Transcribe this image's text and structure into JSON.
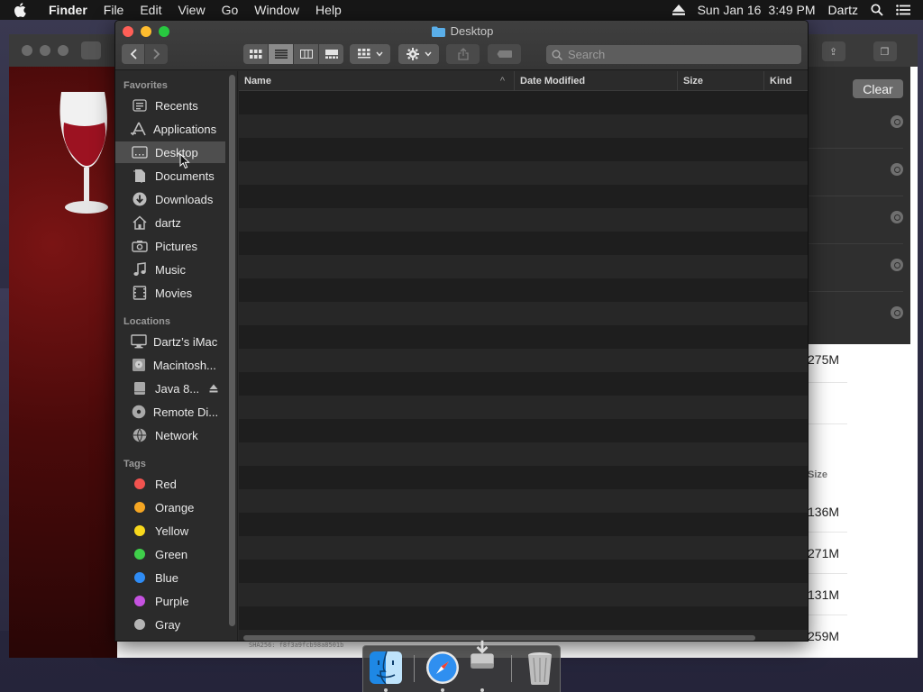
{
  "menubar": {
    "app_name": "Finder",
    "items": [
      "File",
      "Edit",
      "View",
      "Go",
      "Window",
      "Help"
    ],
    "date": "Sun Jan 16",
    "time": "3:49 PM",
    "user": "Dartz"
  },
  "finder": {
    "title": "Desktop",
    "search_placeholder": "Search",
    "columns": {
      "name": "Name",
      "date_modified": "Date Modified",
      "size": "Size",
      "kind": "Kind"
    },
    "rows": []
  },
  "sidebar": {
    "favorites_header": "Favorites",
    "favorites": [
      {
        "label": "Recents",
        "icon": "recents-icon"
      },
      {
        "label": "Applications",
        "icon": "applications-icon"
      },
      {
        "label": "Desktop",
        "icon": "desktop-icon",
        "selected": true
      },
      {
        "label": "Documents",
        "icon": "documents-icon"
      },
      {
        "label": "Downloads",
        "icon": "downloads-icon"
      },
      {
        "label": "dartz",
        "icon": "home-icon"
      },
      {
        "label": "Pictures",
        "icon": "pictures-icon"
      },
      {
        "label": "Music",
        "icon": "music-icon"
      },
      {
        "label": "Movies",
        "icon": "movies-icon"
      }
    ],
    "locations_header": "Locations",
    "locations": [
      {
        "label": "Dartz’s iMac",
        "icon": "computer-icon"
      },
      {
        "label": "Macintosh...",
        "icon": "hard-drive-icon"
      },
      {
        "label": "Java 8...",
        "icon": "disk-image-icon",
        "ejectable": true
      },
      {
        "label": "Remote Di...",
        "icon": "remote-disc-icon"
      },
      {
        "label": "Network",
        "icon": "network-icon"
      }
    ],
    "tags_header": "Tags",
    "tags": [
      {
        "label": "Red",
        "color": "#f2534f"
      },
      {
        "label": "Orange",
        "color": "#f5a623"
      },
      {
        "label": "Yellow",
        "color": "#f8d81c"
      },
      {
        "label": "Green",
        "color": "#3fcf4a"
      },
      {
        "label": "Blue",
        "color": "#2f8cf5"
      },
      {
        "label": "Purple",
        "color": "#c552e0"
      },
      {
        "label": "Gray",
        "color": "#b5b5b5"
      }
    ]
  },
  "background": {
    "clear_label": "Clear",
    "size_header": "Size",
    "sizes": [
      "275M",
      "136M",
      "271M",
      "131M",
      "259M"
    ],
    "hash_text": "SHA256: f8f3a9fcb98a8501b"
  },
  "dock": {
    "apps": [
      "finder-icon",
      "safari-icon",
      "installer-disk-icon",
      "trash-icon"
    ]
  },
  "colors": {
    "close": "#ff5f57",
    "minimize": "#febc2e",
    "maximize": "#28c840",
    "selection": "#4e4e4e"
  }
}
